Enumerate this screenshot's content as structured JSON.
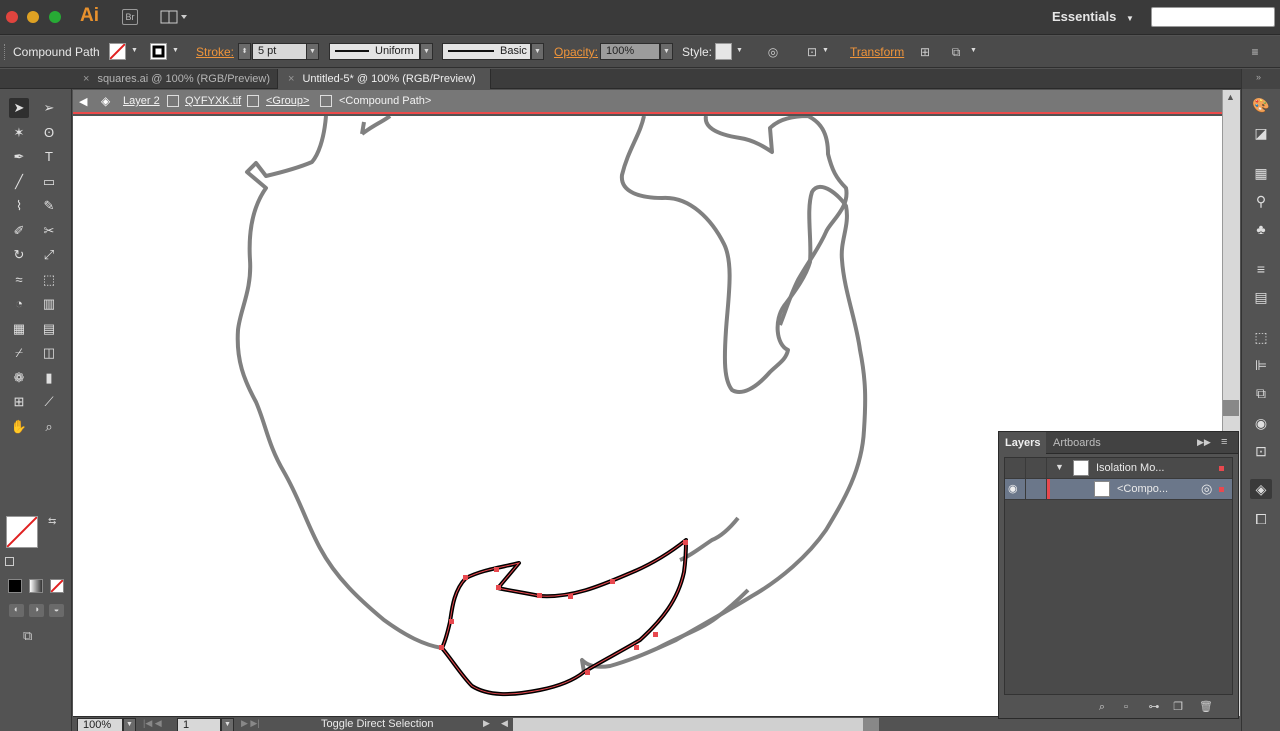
{
  "app": {
    "logo": "Ai",
    "bridge": "Br",
    "workspace": "Essentials",
    "search_placeholder": ""
  },
  "control": {
    "selection_type": "Compound Path",
    "stroke_label": "Stroke:",
    "stroke_weight": "5 pt",
    "profile": "Uniform",
    "brush": "Basic",
    "opacity_label": "Opacity:",
    "opacity_value": "100%",
    "style_label": "Style:",
    "transform_label": "Transform"
  },
  "tabs": [
    {
      "label": "squares.ai @ 100% (RGB/Preview)",
      "active": false
    },
    {
      "label": "Untitled-5* @ 100% (RGB/Preview)",
      "active": true
    }
  ],
  "isolation": {
    "crumbs": [
      "Layer 2",
      "QYFYXK.tif",
      "<Group>",
      "<Compound Path>"
    ]
  },
  "status": {
    "zoom": "100%",
    "artboard": "1",
    "tool_hint": "Toggle Direct Selection"
  },
  "layers_panel": {
    "tabs": [
      "Layers",
      "Artboards"
    ],
    "rows": [
      {
        "name": "Isolation Mo..."
      },
      {
        "name": "<Compo..."
      }
    ]
  },
  "colors": {
    "accent": "#f0953b",
    "isolation_line": "#ec4b4b",
    "selection": "#e8494f"
  },
  "icons": {
    "tools": [
      "selection-tool-icon",
      "direct-selection-tool-icon",
      "magic-wand-icon",
      "lasso-icon",
      "pen-icon",
      "type-icon",
      "line-icon",
      "rectangle-icon",
      "paintbrush-icon",
      "pencil-icon",
      "blob-brush-icon",
      "scissors-icon",
      "rotate-icon",
      "scale-icon",
      "warp-icon",
      "free-transform-icon",
      "shape-builder-icon",
      "graph-icon",
      "mesh-icon",
      "gradient-icon",
      "eyedropper-icon",
      "blend-icon",
      "symbol-sprayer-icon",
      "column-graph-icon",
      "artboard-icon",
      "slice-icon",
      "hand-icon",
      "zoom-icon"
    ]
  }
}
